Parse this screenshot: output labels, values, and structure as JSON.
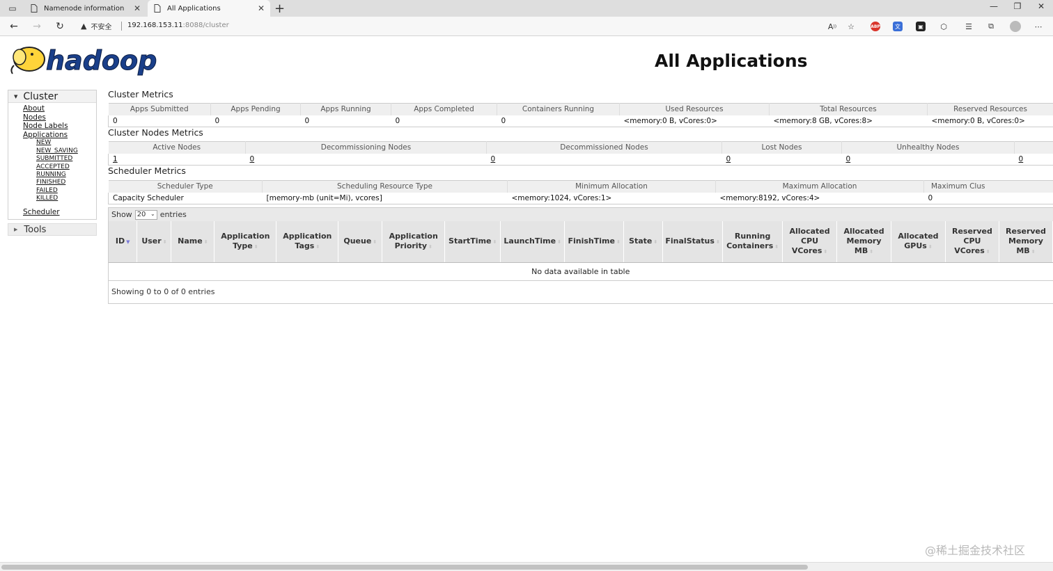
{
  "browser": {
    "tabs": [
      {
        "title": "Namenode information",
        "active": false
      },
      {
        "title": "All Applications",
        "active": true
      }
    ],
    "security_label": "不安全",
    "url_host": "192.168.153.11",
    "url_rest": ":8088/cluster"
  },
  "page": {
    "logo_text": "hadoop",
    "title": "All Applications"
  },
  "sidebar": {
    "cluster_label": "Cluster",
    "links": [
      "About",
      "Nodes",
      "Node Labels",
      "Applications"
    ],
    "app_states": [
      "NEW",
      "NEW_SAVING",
      "SUBMITTED",
      "ACCEPTED",
      "RUNNING",
      "FINISHED",
      "FAILED",
      "KILLED"
    ],
    "scheduler_link": "Scheduler",
    "tools_label": "Tools"
  },
  "cluster_metrics": {
    "title": "Cluster Metrics",
    "headers": [
      "Apps Submitted",
      "Apps Pending",
      "Apps Running",
      "Apps Completed",
      "Containers Running",
      "Used Resources",
      "Total Resources",
      "Reserved Resources"
    ],
    "values": [
      "0",
      "0",
      "0",
      "0",
      "0",
      "<memory:0 B, vCores:0>",
      "<memory:8 GB, vCores:8>",
      "<memory:0 B, vCores:0>"
    ]
  },
  "cluster_nodes_metrics": {
    "title": "Cluster Nodes Metrics",
    "headers": [
      "Active Nodes",
      "Decommissioning Nodes",
      "Decommissioned Nodes",
      "Lost Nodes",
      "Unhealthy Nodes",
      ""
    ],
    "values": [
      "1",
      "0",
      "0",
      "0",
      "0",
      "0"
    ]
  },
  "scheduler_metrics": {
    "title": "Scheduler Metrics",
    "headers": [
      "Scheduler Type",
      "Scheduling Resource Type",
      "Minimum Allocation",
      "Maximum Allocation",
      "Maximum Clus"
    ],
    "values": [
      "Capacity Scheduler",
      "[memory-mb (unit=Mi), vcores]",
      "<memory:1024, vCores:1>",
      "<memory:8192, vCores:4>",
      "0"
    ]
  },
  "apps_table": {
    "show_label": "Show",
    "page_size": "20",
    "entries_label": "entries",
    "columns": [
      [
        "ID"
      ],
      [
        "User"
      ],
      [
        "Name"
      ],
      [
        "Application",
        "Type"
      ],
      [
        "Application",
        "Tags"
      ],
      [
        "Queue"
      ],
      [
        "Application",
        "Priority"
      ],
      [
        "StartTime"
      ],
      [
        "LaunchTime"
      ],
      [
        "FinishTime"
      ],
      [
        "State"
      ],
      [
        "FinalStatus"
      ],
      [
        "Running",
        "Containers"
      ],
      [
        "Allocated",
        "CPU",
        "VCores"
      ],
      [
        "Allocated",
        "Memory",
        "MB"
      ],
      [
        "Allocated",
        "GPUs"
      ],
      [
        "Reserved",
        "CPU",
        "VCores"
      ],
      [
        "Reserved",
        "Memory",
        "MB"
      ]
    ],
    "empty_message": "No data available in table",
    "info": "Showing 0 to 0 of 0 entries"
  },
  "watermark": "@稀土掘金技术社区"
}
